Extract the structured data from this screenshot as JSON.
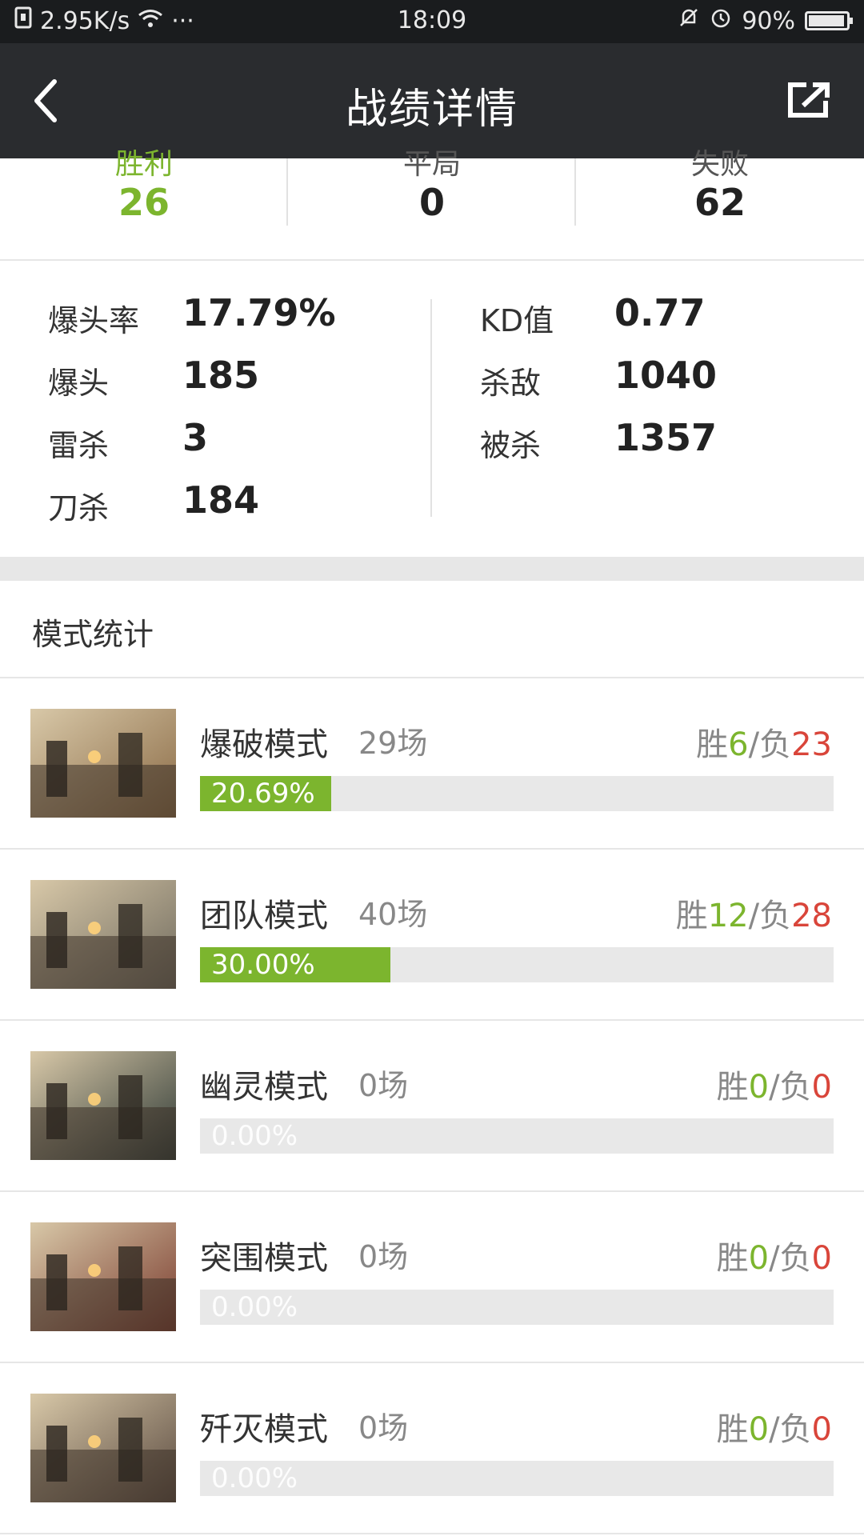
{
  "status_bar": {
    "speed": "2.95K/s",
    "dots": "···",
    "time": "18:09",
    "battery": "90%"
  },
  "header": {
    "title": "战绩详情"
  },
  "summary": [
    {
      "label": "胜利",
      "value": "26"
    },
    {
      "label": "平局",
      "value": "0"
    },
    {
      "label": "失败",
      "value": "62"
    }
  ],
  "stats": {
    "left": [
      {
        "label": "爆头率",
        "value": "17.79%"
      },
      {
        "label": "爆头",
        "value": "185"
      },
      {
        "label": "雷杀",
        "value": "3"
      },
      {
        "label": "刀杀",
        "value": "184"
      }
    ],
    "right": [
      {
        "label": "KD值",
        "value": "0.77"
      },
      {
        "label": "杀敌",
        "value": "1040"
      },
      {
        "label": "被杀",
        "value": "1357"
      }
    ]
  },
  "modes_title": "模式统计",
  "modes": [
    {
      "name": "爆破模式",
      "count": "29场",
      "win_prefix": "胜",
      "wins": "6",
      "sep": "/负",
      "losses": "23",
      "percent_label": "20.69%",
      "percent": 20.69,
      "thumb_color": "#8a6a45"
    },
    {
      "name": "团队模式",
      "count": "40场",
      "win_prefix": "胜",
      "wins": "12",
      "sep": "/负",
      "losses": "28",
      "percent_label": "30.00%",
      "percent": 30.0,
      "thumb_color": "#6f6a5e"
    },
    {
      "name": "幽灵模式",
      "count": "0场",
      "win_prefix": "胜",
      "wins": "0",
      "sep": "/负",
      "losses": "0",
      "percent_label": "0.00%",
      "percent": 0,
      "thumb_color": "#2f3a36"
    },
    {
      "name": "突围模式",
      "count": "0场",
      "win_prefix": "胜",
      "wins": "0",
      "sep": "/负",
      "losses": "0",
      "percent_label": "0.00%",
      "percent": 0,
      "thumb_color": "#7a3b2e"
    },
    {
      "name": "歼灭模式",
      "count": "0场",
      "win_prefix": "胜",
      "wins": "0",
      "sep": "/负",
      "losses": "0",
      "percent_label": "0.00%",
      "percent": 0,
      "thumb_color": "#5a4a40"
    }
  ],
  "colors": {
    "accent_green": "#7cb52e",
    "loss_red": "#d9453a",
    "header_bg": "#2a2c2f"
  }
}
